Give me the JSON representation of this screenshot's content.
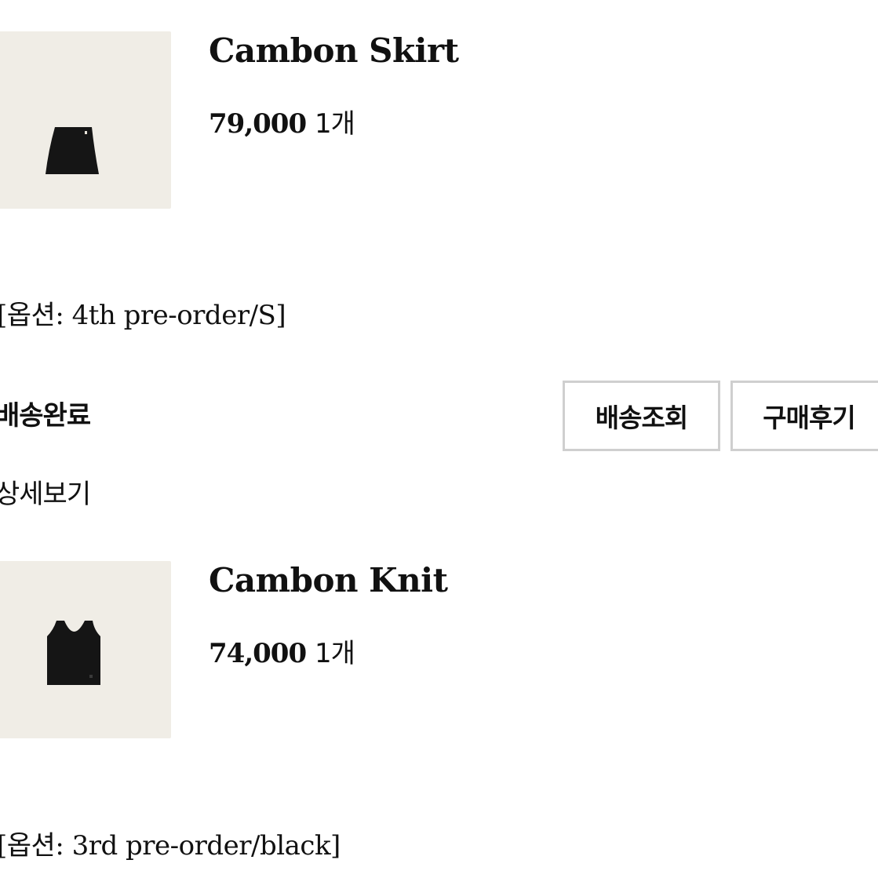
{
  "orders": [
    {
      "image_icon": "skirt-thumbnail",
      "title": "Cambon Skirt",
      "price": "79,000",
      "quantity": "1개",
      "option": "[옵션: 4th pre-order/S]",
      "status": "배송완료",
      "buttons": {
        "track": "배송조회",
        "review": "구매후기"
      },
      "detail_link": "상세보기"
    },
    {
      "image_icon": "knit-thumbnail",
      "title": "Cambon Knit",
      "price": "74,000",
      "quantity": "1개",
      "option": "[옵션: 3rd pre-order/black]"
    }
  ],
  "colors": {
    "thumbnail_bg": "#f0ede6",
    "garment": "#151515",
    "button_border": "#cfcfcf",
    "text": "#111111"
  }
}
